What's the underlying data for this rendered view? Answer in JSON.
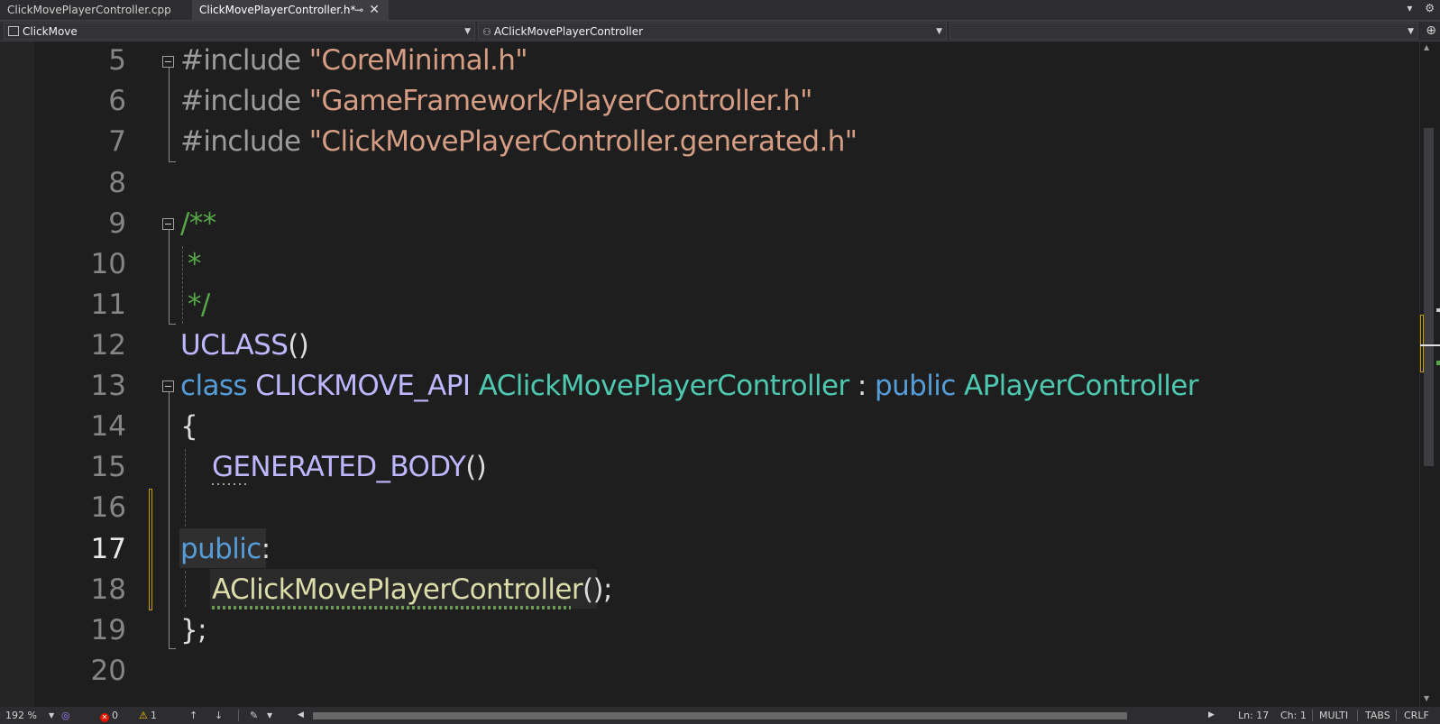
{
  "tabs": [
    {
      "label": "ClickMovePlayerController.cpp",
      "active": false
    },
    {
      "label": "ClickMovePlayerController.h*",
      "active": true
    }
  ],
  "tab_icons": {
    "pin": "⊸",
    "close": "✕",
    "dropdown": "▾",
    "settings": "⚙"
  },
  "navbar": {
    "project": "ClickMove",
    "scope": "AClickMovePlayerController",
    "member": ""
  },
  "editor": {
    "line_numbers": [
      "5",
      "6",
      "7",
      "8",
      "9",
      "10",
      "11",
      "12",
      "13",
      "14",
      "15",
      "16",
      "17",
      "18",
      "19",
      "20"
    ],
    "current_line": "17",
    "code": {
      "l5_pp": "#include ",
      "l5_str": "\"CoreMinimal.h\"",
      "l6_pp": "#include ",
      "l6_str": "\"GameFramework/PlayerController.h\"",
      "l7_pp": "#include ",
      "l7_str": "\"ClickMovePlayerController.generated.h\"",
      "l9": "/**",
      "l10": "*",
      "l11": "*/",
      "l12_mac": "UCLASS",
      "l12_p": "()",
      "l13_kw": "class ",
      "l13_mac": "CLICKMOVE_API ",
      "l13_typ": "AClickMovePlayerController",
      "l13_p": " : ",
      "l13_kw2": "public ",
      "l13_typ2": "APlayerController",
      "l14": "{",
      "l15_mac": "GENERATED_BODY",
      "l15_p": "()",
      "l17_kw": "public",
      "l17_p": ":",
      "l18_fn": "AClickMovePlayerController",
      "l18_p": "();",
      "l19": "};"
    },
    "colors": {
      "string": "#d69d85",
      "comment": "#57a64a",
      "macro": "#beb7ff",
      "keyword": "#569cd6",
      "type": "#4ec9b0",
      "function": "#dcdcaa"
    }
  },
  "statusbar": {
    "zoom": "192 %",
    "errors": "0",
    "warnings": "1",
    "ln": "Ln: 17",
    "ch": "Ch: 1",
    "mode": "MULTI",
    "indent": "TABS",
    "eol": "CRLF"
  }
}
